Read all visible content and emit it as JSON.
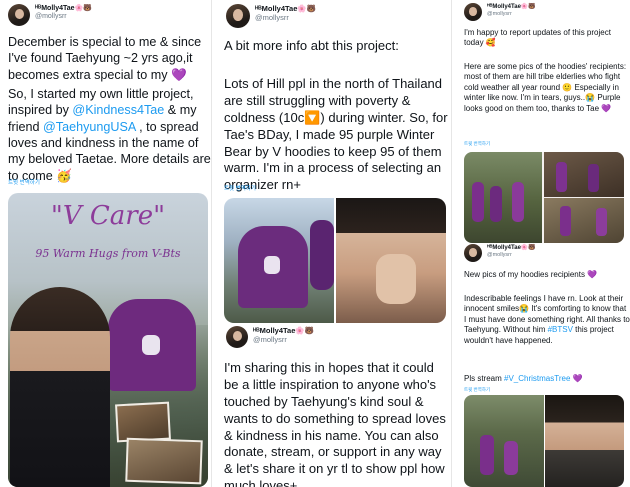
{
  "author": {
    "name": "ᴴᴮMolly4Tae",
    "name_emoji": "🌸🐻",
    "handle": "@mollysrr"
  },
  "translate_label": "트윗 번역하기",
  "col1": {
    "p1": "December is special to me & since I've found Taehyung ~2 yrs ago,it becomes extra special to my 💜",
    "p2_a": "So, I started my own little project, inspired by ",
    "p2_link1": "@Kindness4Tae",
    "p2_b": " & my friend ",
    "p2_link2": "@TaehyungUSA",
    "p2_c": " , to spread loves and kindness in the name of my beloved Taetae. More details are to come 🥳",
    "poster_title": "\"V Care\"",
    "poster_sub": "95 Warm Hugs from V-Bts"
  },
  "col2": {
    "p1": "A bit more info abt this project:",
    "p2": "Lots of Hill ppl in the north of Thailand are still struggling with poverty & coldness (10c🔽) during winter. So, for Tae's BDay, I made 95 purple Winter Bear by V hoodies to keep 95 of them warm. I'm in a process of selecting an organizer rn+",
    "p3": "I'm sharing this in hopes that it could be a little inspiration to anyone who's touched by Taehyung's kind soul & wants to do something to spread loves & kindness in his name. You can also donate, stream, or support in any way & let's share it on yr tl to show ppl how much loves+"
  },
  "col3": {
    "p1": "I'm happy to report updates of this project today 🥰",
    "p2": "Here are some pics of the hoodies' recipients: most of them are hill tribe elderlies who fight cold weather all year round 🙂 Especially in winter like now. I'm in tears, guys..😭 Purple looks good on them too, thanks to Tae 💜",
    "p3": "New pics of my hoodies recipients 💜",
    "p4_a": "Indescribable feelings I have rn. Look at their innocent smiles😭 It's comforting to know that I must have done something right. All thanks to Taehyung. Without him ",
    "p4_hash": "#BTSV",
    "p4_b": " this project wouldn't have happened.",
    "p5_a": "Pls stream ",
    "p5_hash": "#V_ChristmasTree",
    "p5_b": " 💜"
  }
}
